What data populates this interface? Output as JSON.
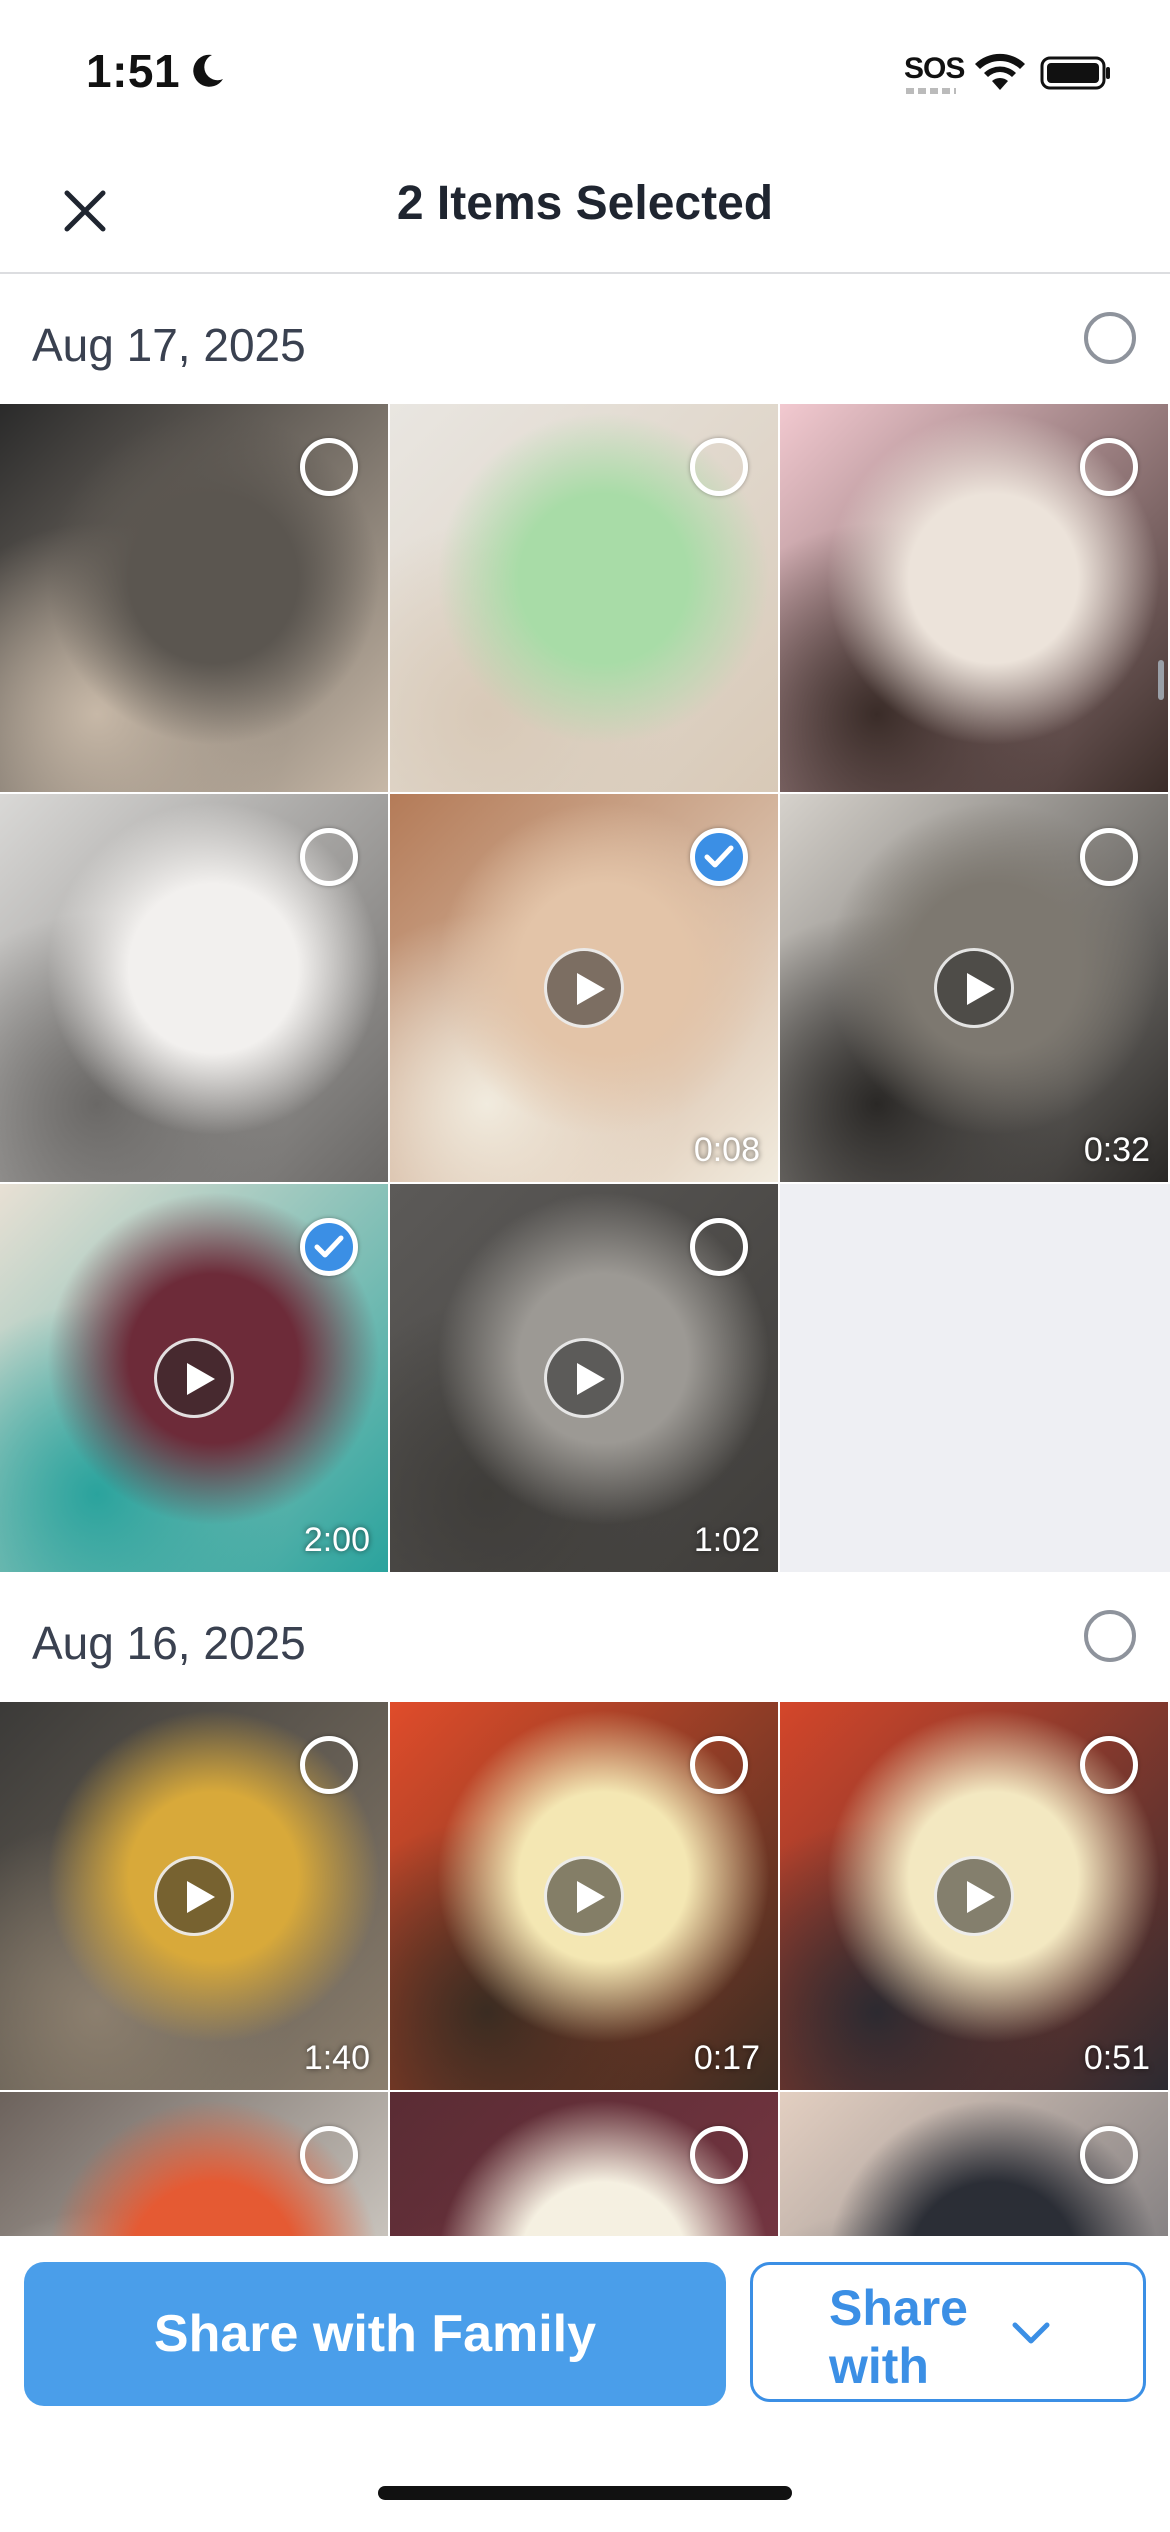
{
  "status_bar": {
    "time": "1:51",
    "sos": "SOS"
  },
  "header": {
    "title": "2 Items Selected"
  },
  "sections": [
    {
      "date": "Aug 17, 2025",
      "tiles": [
        {
          "kind": "photo",
          "selected": false,
          "colors": [
            "#2a2a2a",
            "#5b5650",
            "#c7b8a7"
          ]
        },
        {
          "kind": "photo",
          "selected": false,
          "colors": [
            "#e9e6e1",
            "#a8dca7",
            "#d8c9b7"
          ]
        },
        {
          "kind": "photo",
          "selected": false,
          "colors": [
            "#f2c9d0",
            "#ece3da",
            "#3a2c28"
          ]
        },
        {
          "kind": "photo",
          "selected": false,
          "colors": [
            "#d9d8d6",
            "#f2f0ee",
            "#6a6866"
          ]
        },
        {
          "kind": "video",
          "selected": true,
          "duration": "0:08",
          "colors": [
            "#b47b58",
            "#e3c4a8",
            "#f1ebde"
          ]
        },
        {
          "kind": "video",
          "selected": false,
          "duration": "0:32",
          "colors": [
            "#d6d2cc",
            "#7d7870",
            "#2a2826"
          ]
        },
        {
          "kind": "video",
          "selected": true,
          "duration": "2:00",
          "colors": [
            "#e8e0d4",
            "#6d2b39",
            "#2aa39d"
          ]
        },
        {
          "kind": "video",
          "selected": false,
          "duration": "1:02",
          "colors": [
            "#5c5a58",
            "#9c9994",
            "#3f3d3a"
          ]
        }
      ]
    },
    {
      "date": "Aug 16, 2025",
      "tiles": [
        {
          "kind": "video",
          "selected": false,
          "duration": "1:40",
          "colors": [
            "#3b3a38",
            "#d8a93a",
            "#8c7f6e"
          ]
        },
        {
          "kind": "video",
          "selected": false,
          "duration": "0:17",
          "colors": [
            "#e04c2a",
            "#f4e7b3",
            "#3a2c22"
          ]
        },
        {
          "kind": "video",
          "selected": false,
          "duration": "0:51",
          "colors": [
            "#d4462a",
            "#f3e8c1",
            "#2c2a30"
          ]
        },
        {
          "kind": "photo",
          "selected": false,
          "colors": [
            "#6c625c",
            "#e55a33",
            "#f2efe8"
          ]
        },
        {
          "kind": "photo",
          "selected": false,
          "colors": [
            "#5a2c34",
            "#f5f0e1",
            "#7e3946"
          ]
        },
        {
          "kind": "photo",
          "selected": false,
          "colors": [
            "#e3cfc1",
            "#2b2e36",
            "#5d6068"
          ]
        }
      ]
    }
  ],
  "actions": {
    "share_family": "Share with Family",
    "share_with": "Share with"
  },
  "theme": {
    "accent": "#3b8fe5",
    "primary_button": "#4a9eea"
  },
  "icons": {
    "close": "close-icon",
    "moon": "moon-icon",
    "wifi": "wifi-icon",
    "battery": "battery-icon",
    "chevron": "chevron-down-icon",
    "play": "play-icon",
    "check": "checkmark-icon"
  }
}
